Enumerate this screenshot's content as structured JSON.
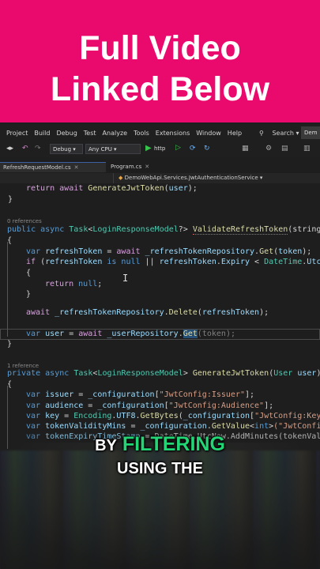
{
  "banner": {
    "line1": "Full Video",
    "line2": "Linked Below"
  },
  "menu": {
    "items": [
      "Project",
      "Build",
      "Debug",
      "Test",
      "Analyze",
      "Tools",
      "Extensions",
      "Window",
      "Help"
    ],
    "search": "Search",
    "solution": "Dem"
  },
  "toolbar": {
    "config": "Debug",
    "platform": "Any CPU",
    "run": "http"
  },
  "tabs": [
    {
      "label": "RefreshRequestModel.cs"
    },
    {
      "label": "Program.cs"
    }
  ],
  "nav": {
    "member": "DemoWebApi.Services.JwtAuthenticationService"
  },
  "code": {
    "l1_kw": "return",
    "l1_kw2": "await",
    "l1_call": "GenerateJwtToken",
    "l1_arg": "user",
    "refs0": "0 references",
    "sig1": {
      "mod": "public async",
      "type": "Task",
      "gen": "LoginResponseModel",
      "name": "ValidateRefreshToken",
      "tail": "(string"
    },
    "rt_line": {
      "var": "var",
      "name": "refreshToken",
      "await": "await",
      "repo": "_refreshTokenRepository",
      "fn": "Get",
      "arg": "token"
    },
    "if_line": {
      "kw": "if",
      "a": "refreshToken",
      "is": "is null",
      "b": "refreshToken",
      "prop": "Expiry",
      "dt": "DateTime",
      "utc": "Utc"
    },
    "ret_null": {
      "kw": "return",
      "val": "null"
    },
    "del_line": {
      "await": "await",
      "repo": "_refreshTokenRepository",
      "fn": "Delete",
      "arg": "refreshToken"
    },
    "user_line": {
      "var": "var",
      "name": "user",
      "await": "await",
      "repo": "_userRepository",
      "fn": "Get",
      "arg": "token"
    },
    "refs1": "1 reference",
    "sig2": {
      "mod": "private async",
      "type": "Task",
      "gen": "LoginResponseModel",
      "name": "GenerateJwtToken",
      "ptype": "User",
      "param": "user"
    },
    "issuer": {
      "name": "issuer",
      "cfg": "_configuration",
      "key": "\"JwtConfig:Issuer\""
    },
    "audience": {
      "name": "audience",
      "cfg": "_configuration",
      "key": "\"JwtConfig:Audience\""
    },
    "keyline": {
      "name": "key",
      "enc": "Encoding",
      "utf": "UTF8",
      "fn": "GetBytes",
      "cfg": "_configuration",
      "k": "\"JwtConfig:Key\""
    },
    "validity": {
      "name": "tokenValidityMins",
      "cfg": "_configuration",
      "fn": "GetValue",
      "t": "int",
      "k": "(\"JwtConfi"
    },
    "expiry": {
      "name": "tokenExpiryTimeStamp",
      "rest": "= DateTime.UtcNow.AddMinutes(tokenVali"
    }
  },
  "caption": {
    "by": "BY",
    "filtering": "FILTERING",
    "line2": "USING THE"
  },
  "colors": {
    "banner": "#ea0a6e",
    "highlight": "#22d676"
  }
}
